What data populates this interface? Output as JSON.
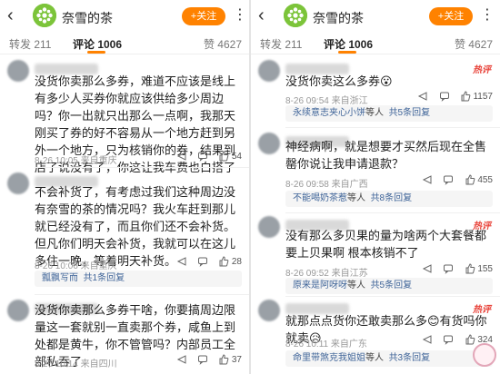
{
  "account": {
    "name": "奈雪的茶",
    "follow_label": "+关注",
    "brand_color": "#ff8200",
    "avatar_color": "#7cc43a"
  },
  "tabs": {
    "repost": "转发 211",
    "comments": "评论 1006",
    "likes": "赞 4627"
  },
  "left_comments": [
    {
      "text": "没货你卖那么多券，难道不应该是线上有多少人买券你就应该供给多少周边吗？你一出就只出那么一点啊，我那天刚买了券的好不容易从一个地方赶到另外一个地方，只为核销你的券，结果到店了说没有了，你这让我车费也白搭了",
      "meta": "8-26 10:05 来自重庆",
      "likes": "54"
    },
    {
      "text": "不会补货了，有考虑过我们这种周边没有奈雪的茶的情况吗？我火车赶到那儿就已经没有了，而且你们还不会补货。但凡你们明天会补货，我就可以在这儿多住一晚，等着明天补货。",
      "meta": "8-26 10:06 来自重庆",
      "likes": "28",
      "reply_name": "瓢飘写而",
      "reply_count": "共1条回复"
    },
    {
      "text": "没货你卖那么多券干啥，你要搞周边限量这一套就别一直卖那个券，咸鱼上到处都是黄牛，你不管管吗？内部员工全部私吞了",
      "meta": "8-26 10:14 来自四川",
      "likes": "37"
    }
  ],
  "right_comments": [
    {
      "hot": "热评",
      "text": "没货你卖这么多券😮",
      "meta": "8-26 09:54 来自浙江",
      "likes": "1157",
      "reply_name": "永续意志夹心小饼",
      "reply_suffix": "等人",
      "reply_count": "共5条回复"
    },
    {
      "text": "神经病啊，就是想要才买然后现在全售罄你说让我申请退款？",
      "meta": "8-26 09:58 来自广西",
      "likes": "455",
      "reply_name": "不能喝奶茶惹",
      "reply_suffix": "等人",
      "reply_count": "共8条回复"
    },
    {
      "hot": "热评",
      "text": "没有那么多贝果的量为啥两个大套餐都要上贝果啊 根本核销不了",
      "meta": "8-26 09:52 来自江苏",
      "likes": "155",
      "reply_name": "原来是阿呀呀",
      "reply_suffix": "等人",
      "reply_count": "共5条回复"
    },
    {
      "hot": "热评",
      "text": "就那点点货你还敢卖那么多😊有货吗你就卖😥",
      "meta": "8-26 10:11 来自广东",
      "likes": "324",
      "reply_name": "命里带煞克我姐姐",
      "reply_suffix": "等人",
      "reply_count": "共3条回复"
    }
  ]
}
